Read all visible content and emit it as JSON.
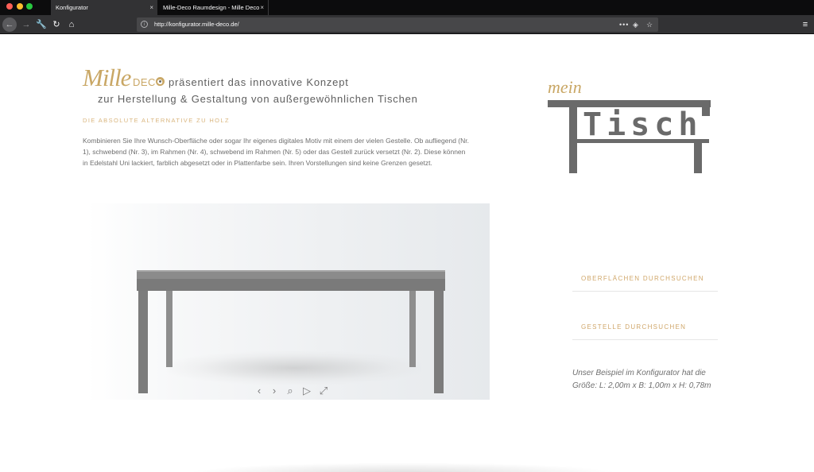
{
  "browser": {
    "tabs": [
      {
        "label": "Konfigurator",
        "active": true
      },
      {
        "label": "Mille-Deco Raumdesign - Mille Deco",
        "active": false
      }
    ],
    "tab_close": "×",
    "url": "http://konfigurator.mille-deco.de/",
    "icons": {
      "back": "←",
      "forward": "→",
      "tools": "🔧",
      "reload": "↻",
      "home": "⌂",
      "info": "i",
      "more": "•••",
      "pocket": "◈",
      "star": "☆",
      "menu": "≡"
    }
  },
  "header": {
    "logo_mille": "Mille",
    "logo_deco": "DECO",
    "headline_line1": "präsentiert das innovative Konzept",
    "headline_line2": "zur Herstellung & Gestaltung von außergewöhnlichen Tischen",
    "subheading": "DIE ABSOLUTE ALTERNATIVE ZU HOLZ",
    "body": "Kombinieren Sie Ihre Wunsch-Oberfläche oder sogar Ihr eigenes digitales Motiv mit einem der vielen Gestelle. Ob aufliegend (Nr. 1), schwebend (Nr. 3), im Rahmen (Nr. 4), schwebend im Rahmen (Nr. 5) oder das Gestell zurück versetzt (Nr. 2). Diese können in Edelstahl Uni lackiert, farblich abgesetzt oder in Plattenfarbe sein. Ihren Vorstellungen sind keine Grenzen gesetzt."
  },
  "brand_logo": {
    "mein": "mein",
    "tisch": "Tisch"
  },
  "viewer": {
    "controls": {
      "prev": "‹",
      "next": "›",
      "zoom": "⌕",
      "play": "▷",
      "fullscreen": "⤢"
    }
  },
  "sidebar": {
    "link_surfaces": "OBERFLÄCHEN DURCHSUCHEN",
    "link_frames": "GESTELLE DURCHSUCHEN",
    "note": "Unser Beispiel im Konfigurator hat die Größe: L: 2,00m x B: 1,00m x H: 0,78m"
  },
  "colors": {
    "accent_gold": "#c9a765",
    "text_gray": "#5e5e5e",
    "logo_gray": "#6a6a6a"
  }
}
